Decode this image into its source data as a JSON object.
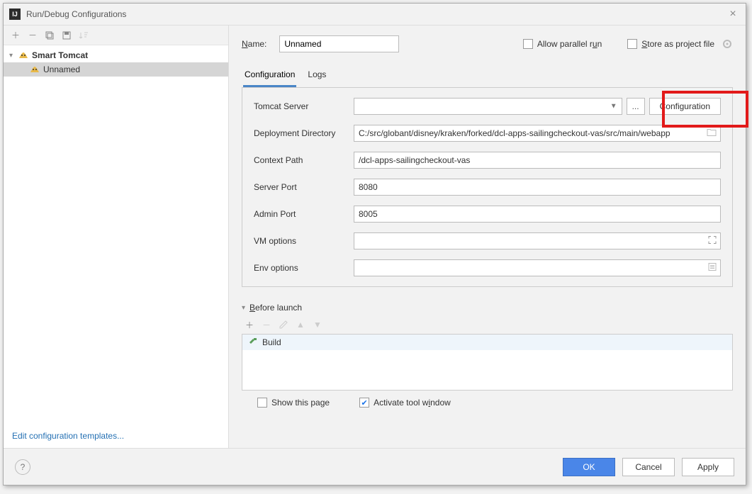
{
  "window": {
    "title": "Run/Debug Configurations"
  },
  "tree": {
    "root_label": "Smart Tomcat",
    "child_label": "Unnamed"
  },
  "edit_templates": "Edit configuration templates...",
  "name": {
    "label": "Name:",
    "value": "Unnamed"
  },
  "allow_parallel": "Allow parallel run",
  "store_project": "Store as project file",
  "tabs": {
    "configuration": "Configuration",
    "logs": "Logs"
  },
  "form": {
    "tomcat_server": {
      "label": "Tomcat Server",
      "value": ""
    },
    "ellipsis": "...",
    "configuration_btn": "Configuration",
    "deploy_dir": {
      "label": "Deployment Directory",
      "value": "C:/src/globant/disney/kraken/forked/dcl-apps-sailingcheckout-vas/src/main/webapp"
    },
    "context_path": {
      "label": "Context Path",
      "value": "/dcl-apps-sailingcheckout-vas"
    },
    "server_port": {
      "label": "Server Port",
      "value": "8080"
    },
    "admin_port": {
      "label": "Admin Port",
      "value": "8005"
    },
    "vm_options": {
      "label": "VM options",
      "value": ""
    },
    "env_options": {
      "label": "Env options",
      "value": ""
    }
  },
  "before_launch": {
    "title": "Before launch",
    "build": "Build",
    "show_page": "Show this page",
    "activate_tool": "Activate tool window"
  },
  "footer": {
    "ok": "OK",
    "cancel": "Cancel",
    "apply": "Apply"
  }
}
